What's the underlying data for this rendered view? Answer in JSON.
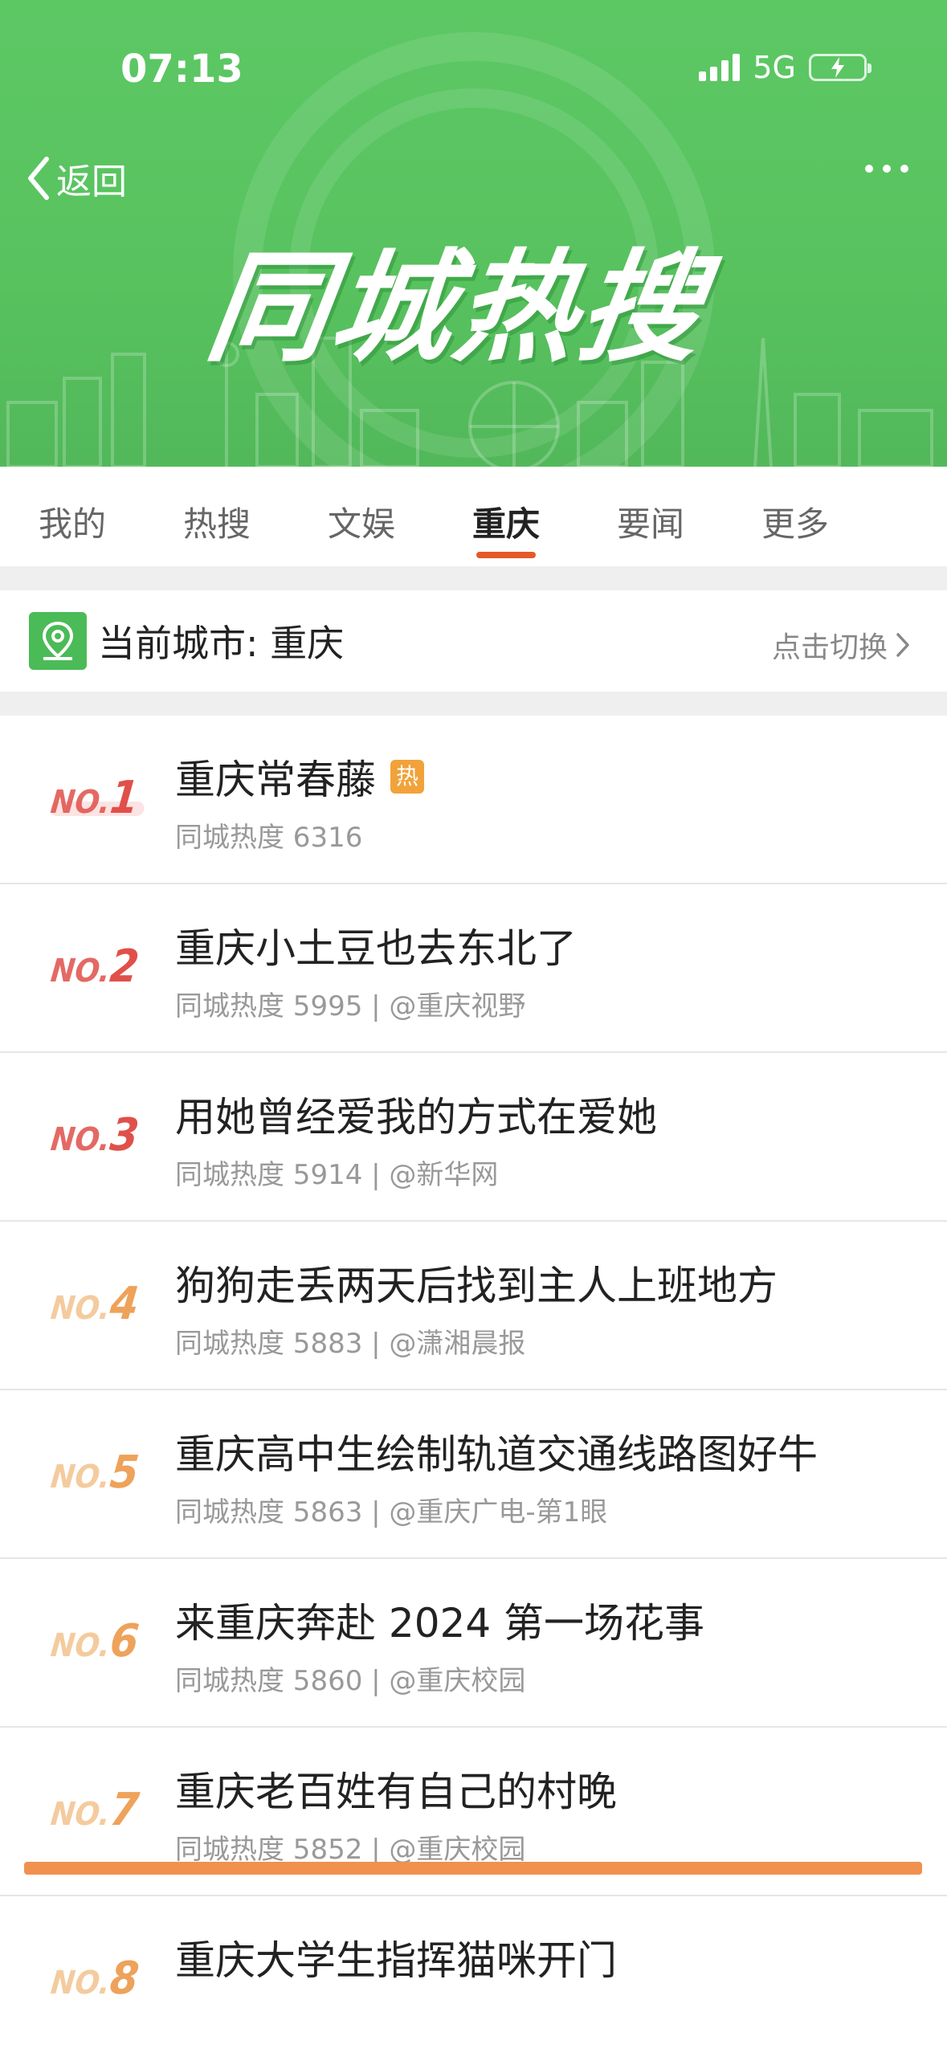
{
  "status": {
    "time": "07:13",
    "network": "5G"
  },
  "header": {
    "back_label": "返回",
    "banner_title": "同城热搜"
  },
  "tabs": [
    {
      "label": "我的"
    },
    {
      "label": "热搜"
    },
    {
      "label": "文娱"
    },
    {
      "label": "重庆",
      "active": true
    },
    {
      "label": "要闻"
    },
    {
      "label": "更多"
    }
  ],
  "city_bar": {
    "label": "当前城市: 重庆",
    "switch_label": "点击切换"
  },
  "list": [
    {
      "no": "NO.",
      "rank": "1",
      "title": "重庆常春藤",
      "badge": "热",
      "sub": "同城热度 6316"
    },
    {
      "no": "NO.",
      "rank": "2",
      "title": "重庆小土豆也去东北了",
      "sub": "同城热度 5995 | @重庆视野"
    },
    {
      "no": "NO.",
      "rank": "3",
      "title": "用她曾经爱我的方式在爱她",
      "sub": "同城热度 5914 | @新华网"
    },
    {
      "no": "NO.",
      "rank": "4",
      "title": "狗狗走丢两天后找到主人上班地方",
      "sub": "同城热度 5883 | @潇湘晨报"
    },
    {
      "no": "NO.",
      "rank": "5",
      "title": "重庆高中生绘制轨道交通线路图好牛",
      "sub": "同城热度 5863 | @重庆广电-第1眼"
    },
    {
      "no": "NO.",
      "rank": "6",
      "title": "来重庆奔赴 2024 第一场花事",
      "sub": "同城热度 5860 | @重庆校园"
    },
    {
      "no": "NO.",
      "rank": "7",
      "title": "重庆老百姓有自己的村晚",
      "sub": "同城热度 5852 | @重庆校园"
    },
    {
      "no": "NO.",
      "rank": "8",
      "title": "重庆大学生指挥猫咪开门",
      "sub": ""
    }
  ],
  "colors": {
    "header_green": "#58c25f",
    "accent_orange": "#e45a2a",
    "rank_red": "#e0504a",
    "rank_orange": "#eea25a",
    "highlight_line": "#f0914f"
  }
}
